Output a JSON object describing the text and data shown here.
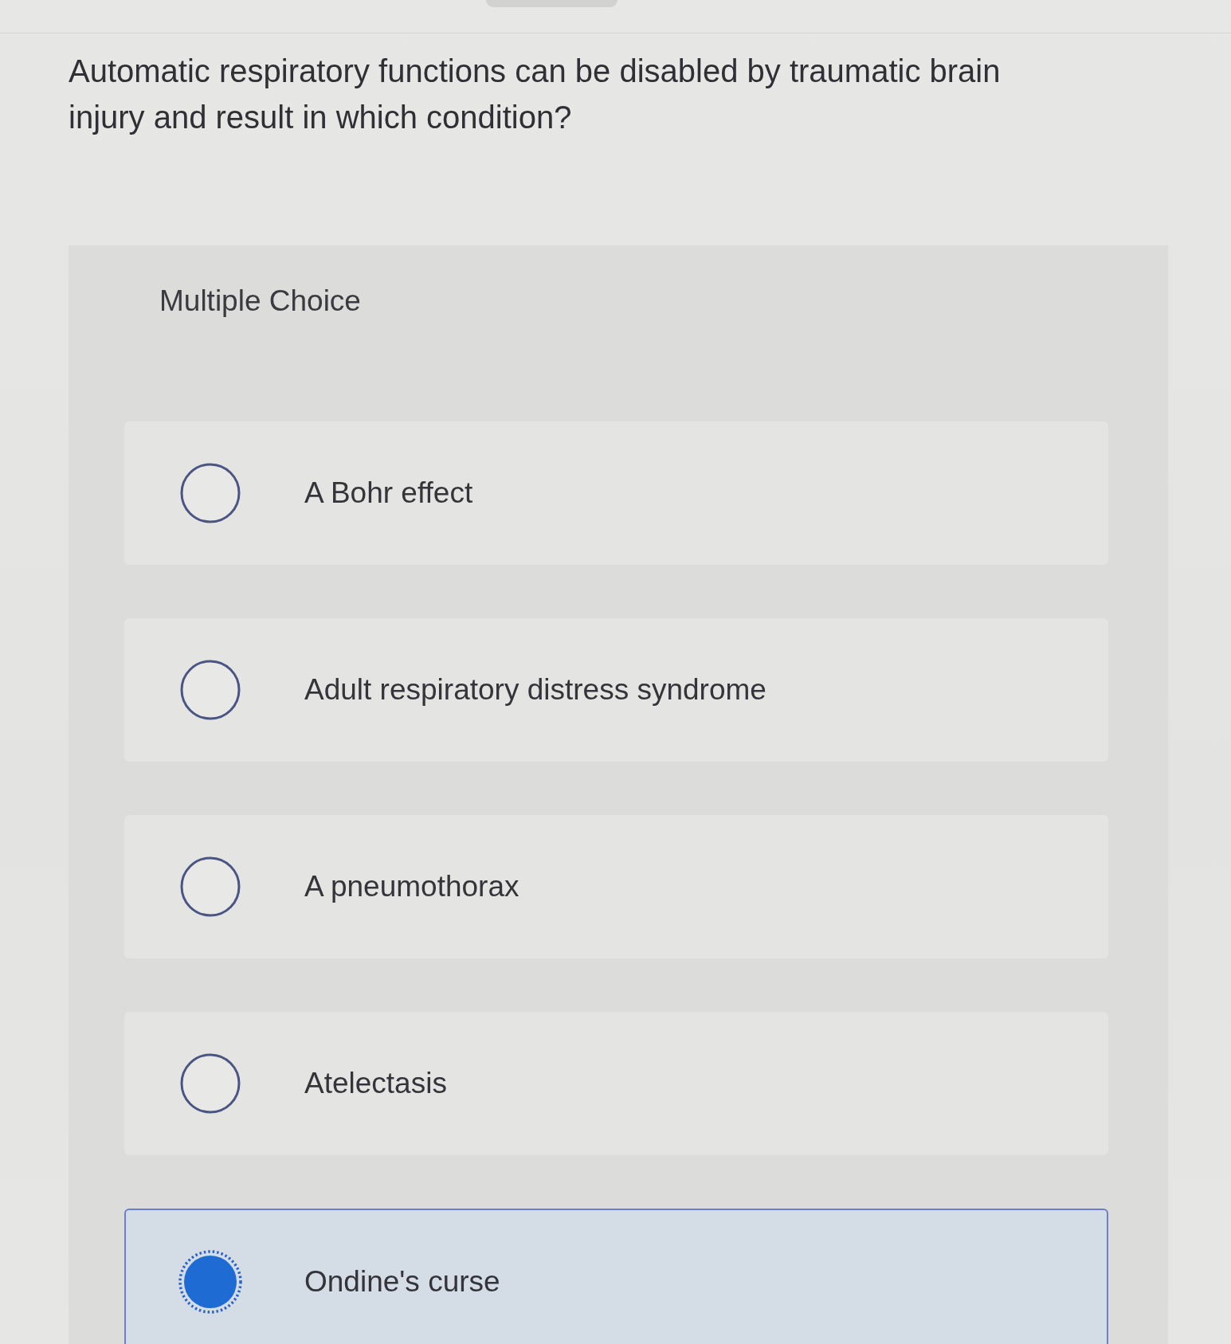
{
  "question": "Automatic respiratory functions can be disabled by traumatic brain injury and result in which condition?",
  "section_label": "Multiple Choice",
  "options": [
    {
      "label": "A Bohr effect",
      "selected": false
    },
    {
      "label": "Adult respiratory distress syndrome",
      "selected": false
    },
    {
      "label": "A pneumothorax",
      "selected": false
    },
    {
      "label": "Atelectasis",
      "selected": false
    },
    {
      "label": "Ondine's curse",
      "selected": true
    }
  ]
}
